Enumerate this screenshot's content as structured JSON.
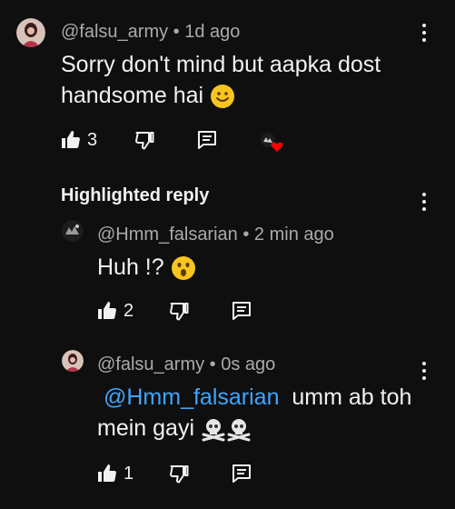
{
  "comment": {
    "author": "@falsu_army",
    "time": "1d ago",
    "text": "Sorry don't mind but aapka dost handsome hai",
    "like_count": "3"
  },
  "highlighted_label": "Highlighted reply",
  "replies": [
    {
      "author": "@Hmm_falsarian",
      "time": "2 min ago",
      "text": "Huh !?",
      "like_count": "2"
    },
    {
      "author": "@falsu_army",
      "time": "0s ago",
      "mention": "@Hmm_falsarian",
      "text_line1": "umm ab toh",
      "text_line2": "mein gayi",
      "like_count": "1"
    }
  ],
  "colors": {
    "background": "#0f0f0f",
    "text": "#f1f1f1",
    "meta": "#aaaaaa",
    "mention": "#3ea6ff",
    "heart": "#ff0000"
  },
  "icons": [
    "like-icon",
    "dislike-icon",
    "reply-icon",
    "creator-heart-icon",
    "more-options-icon",
    "smile-emoji",
    "surprised-emoji",
    "skull-crossbones-emoji"
  ]
}
